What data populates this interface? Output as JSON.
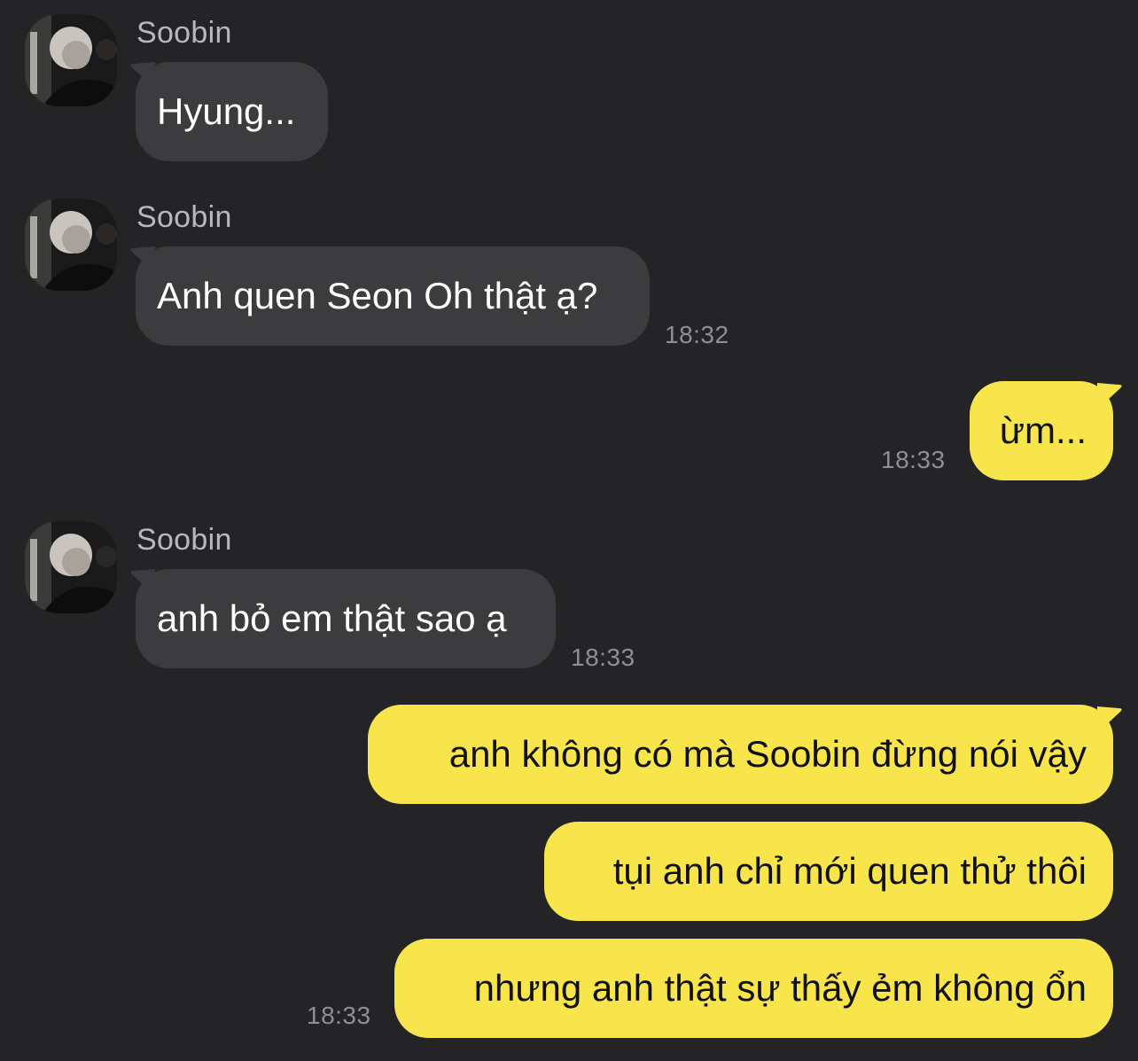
{
  "chat": {
    "accent_outgoing": "#f8e54c",
    "accent_incoming": "#3c3c3e",
    "background": "#242426",
    "messages": [
      {
        "sender": "Soobin",
        "text": "Hyung...",
        "time": ""
      },
      {
        "sender": "Soobin",
        "text": "Anh quen Seon Oh thật ạ?",
        "time": "18:32"
      },
      {
        "sender": "",
        "text": "ừm...",
        "time": "18:33"
      },
      {
        "sender": "Soobin",
        "text": "anh bỏ em thật sao ạ",
        "time": "18:33"
      },
      {
        "sender": "",
        "text": "anh không có mà Soobin đừng nói vậy",
        "time": ""
      },
      {
        "sender": "",
        "text": "tụi anh chỉ mới quen thử thôi",
        "time": ""
      },
      {
        "sender": "",
        "text": "nhưng anh thật sự thấy ẻm không ổn",
        "time": "18:33"
      }
    ]
  }
}
